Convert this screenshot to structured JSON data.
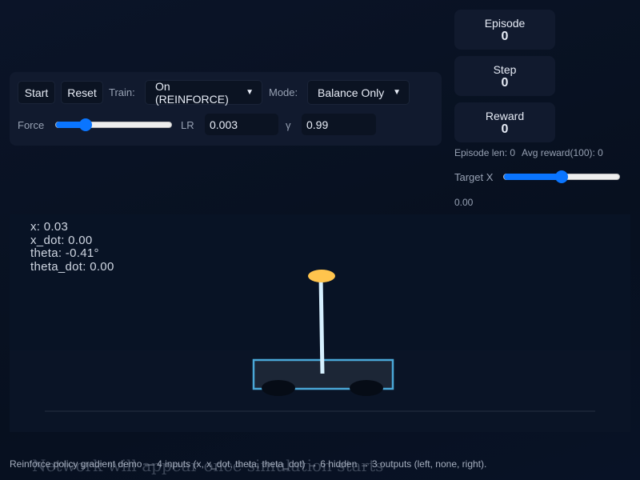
{
  "controls": {
    "start_label": "Start",
    "reset_label": "Reset",
    "train_label": "Train:",
    "train_value": "On (REINFORCE)",
    "mode_label": "Mode:",
    "mode_value": "Balance Only",
    "force_label": "Force",
    "force_slider_fraction": 0.23,
    "lr_label": "LR",
    "lr_value": "0.003",
    "gamma_label": "γ",
    "gamma_value": "0.99"
  },
  "stats": {
    "cards": [
      {
        "title": "Episode",
        "value": "0"
      },
      {
        "title": "Step",
        "value": "0"
      },
      {
        "title": "Reward",
        "value": "0"
      }
    ],
    "episode_len": "Episode len: 0",
    "avg_reward": "Avg reward(100): 0",
    "target_label": "Target X",
    "target_fraction": 0.5,
    "target_value": "0.00"
  },
  "sim": {
    "x": "x: 0.03",
    "x_dot": "x_dot: 0.00",
    "theta": "theta: -0.41°",
    "theta_dot": "theta_dot: 0.00",
    "colors": {
      "cart": "#4aa8d8",
      "pole": "#d6f0ff",
      "bob": "#ffc44d"
    }
  },
  "footer": {
    "description": "Reinforce policy gradient demo — 4 inputs (x, x_dot, theta, theta_dot) → 6 hidden → 3 outputs (left, none, right).",
    "network_placeholder": "Network will appear once simulation starts"
  }
}
